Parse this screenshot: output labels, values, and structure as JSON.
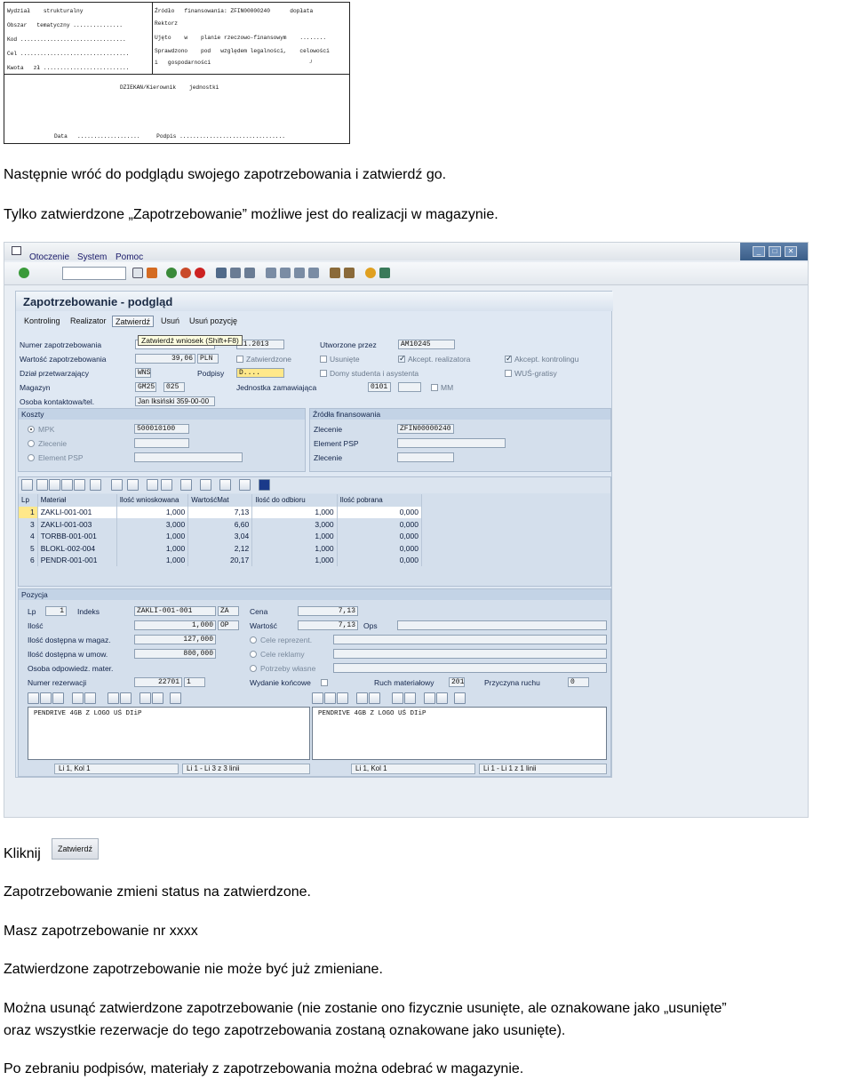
{
  "form_scan": {
    "left_lines": [
      "Wydział    strukturalny",
      "Obszar   tematyczny ...............",
      "Kod ................................",
      "Cel .................................",
      "Kwota   zł .........................."
    ],
    "right_lines": [
      "Źródło   finansowania: ZFIN00000240      dopłata",
      "Rektorz",
      "Ujęto    w    planie rzeczowo-finansowym    ........",
      "Sprawdzono    pod   względem legalności,    celowości",
      "i   gospodarności                              ┘"
    ],
    "center_line": "DZIEKAN/Kierownik    jednostki",
    "bottom_line": "Data   ...................     Podpis ................................"
  },
  "intro": {
    "line1": "Następnie wróć do podglądu swojego zapotrzebowania i zatwierdź go.",
    "line2": "Tylko zatwierdzone „Zapotrzebowanie” możliwe jest do realizacji w magazynie."
  },
  "sap": {
    "menu": [
      "Otoczenie",
      "System",
      "Pomoc"
    ],
    "window_buttons": [
      "_",
      "□",
      "✕"
    ],
    "page_title": "Zapotrzebowanie - podgląd",
    "app_buttons": [
      "Kontroling",
      "Realizator",
      "Zatwierdź",
      "Usuń",
      "Usuń pozycję"
    ],
    "tooltip": "Zatwierdź wniosek   (Shift+F8)",
    "header": {
      "numer_label": "Numer zapotrzebowania",
      "numer_date": "11.2013",
      "wartosc_label": "Wartość zapotrzebowania",
      "wartosc_value": "39,06",
      "wartosc_currency": "PLN",
      "dzial_label": "Dział przetwarzający",
      "dzial_value": "WNS",
      "podpisy_label": "Podpisy",
      "podpisy_value": "D....",
      "magazyn_label": "Magazyn",
      "magazyn_value1": "GM25",
      "magazyn_value2": "025",
      "jednostka_label": "Jednostka zamawiająca",
      "jednostka_value": "0101",
      "osoba_label": "Osoba kontaktowa/tel.",
      "osoba_value": "Jan Iksiński 359-00-00",
      "utworzone_label": "Utworzone przez",
      "utworzone_value": "AM10245",
      "chk_zatwierdzone": "Zatwierdzone",
      "chk_usuniete": "Usunięte",
      "chk_akcept_real": "Akcept. realizatora",
      "chk_akcept_kontr": "Akcept. kontrolingu",
      "chk_domy": "Domy studenta i asystenta",
      "chk_wus": "WUŚ-gratisy",
      "chk_mm": "MM"
    },
    "koszty": {
      "title": "Koszty",
      "mpk_label": "MPK",
      "mpk_value": "500010100",
      "zlecenie_label": "Zlecenie",
      "element_label": "Element PSP"
    },
    "zrodla": {
      "title": "Źródła finansowania",
      "zlecenie_label": "Zlecenie",
      "zlecenie_value": "ZFIN00000240",
      "element_label": "Element PSP",
      "zlecenie2_label": "Zlecenie"
    },
    "table": {
      "columns": [
        "Lp",
        "Materiał",
        "Ilość wnioskowana",
        "WartośćMat",
        "Ilość do odbioru",
        "Ilość pobrana"
      ],
      "rows": [
        [
          "1",
          "ZAKLI-001-001",
          "1,000",
          "7,13",
          "1,000",
          "0,000"
        ],
        [
          "3",
          "ZAKLI-001-003",
          "3,000",
          "6,60",
          "3,000",
          "0,000"
        ],
        [
          "4",
          "TORBB-001-001",
          "1,000",
          "3,04",
          "1,000",
          "0,000"
        ],
        [
          "5",
          "BLOKL-002-004",
          "1,000",
          "2,12",
          "1,000",
          "0,000"
        ],
        [
          "6",
          "PENDR-001-001",
          "1,000",
          "20,17",
          "1,000",
          "0,000"
        ]
      ]
    },
    "pozycja": {
      "title": "Pozycja",
      "lp_label": "Lp",
      "lp_value": "1",
      "indeks_label": "Indeks",
      "indeks_value": "ZAKLI-001-001",
      "indeks_unit": "ZA",
      "cena_label": "Cena",
      "cena_value": "7,13",
      "ilosc_label": "Ilość",
      "ilosc_value": "1,000",
      "ilosc_unit": "OP",
      "wartosc_label": "Wartość",
      "wartosc_value": "7,13",
      "ops_label": "Ops",
      "dost_mag_label": "Ilość dostępna w magaz.",
      "dost_mag_value": "127,000",
      "dost_umow_label": "Ilość dostępna w umow.",
      "dost_umow_value": "800,000",
      "osoba_label": "Osoba odpowiedz. mater.",
      "rad_cele": "Cele reprezent.",
      "rad_reklamy": "Cele reklamy",
      "rad_potrzeby": "Potrzeby własne",
      "rez_label": "Numer rezerwacji",
      "rez_value": "22701",
      "rez_pos": "1",
      "wydanie_label": "Wydanie końcowe",
      "ruch_label": "Ruch materiałowy",
      "ruch_value": "201",
      "przyczyna_label": "Przyczyna ruchu",
      "przyczyna_value": "0",
      "text_left": "PENDRIVE 4GB Z LOGO UŚ DIiP",
      "text_right": "PENDRIVE 4GB Z LOGO UŚ DIiP",
      "status": [
        "Li 1, Kol 1",
        "Li 1 - Li 3 z 3 linii",
        "Li 1, Kol 1",
        "Li 1 - Li 1 z 1 linii"
      ]
    }
  },
  "kliknij": {
    "label": "Kliknij",
    "button_label": "Zatwierdź"
  },
  "body_text": {
    "p1": "Zapotrzebowanie zmieni status na zatwierdzone.",
    "p2": "Masz zapotrzebowanie nr xxxx",
    "p3": "Zatwierdzone zapotrzebowanie nie może być już zmieniane.",
    "p4a": "Można usunąć zatwierdzone zapotrzebowanie (nie zostanie ono fizycznie usunięte, ale oznakowane jako „usunięte”",
    "p4b": "oraz wszystkie rezerwacje do tego zapotrzebowania zostaną oznakowane jako usunięte).",
    "p5": "Po zebraniu podpisów, materiały z zapotrzebowania można odebrać w magazynie."
  }
}
